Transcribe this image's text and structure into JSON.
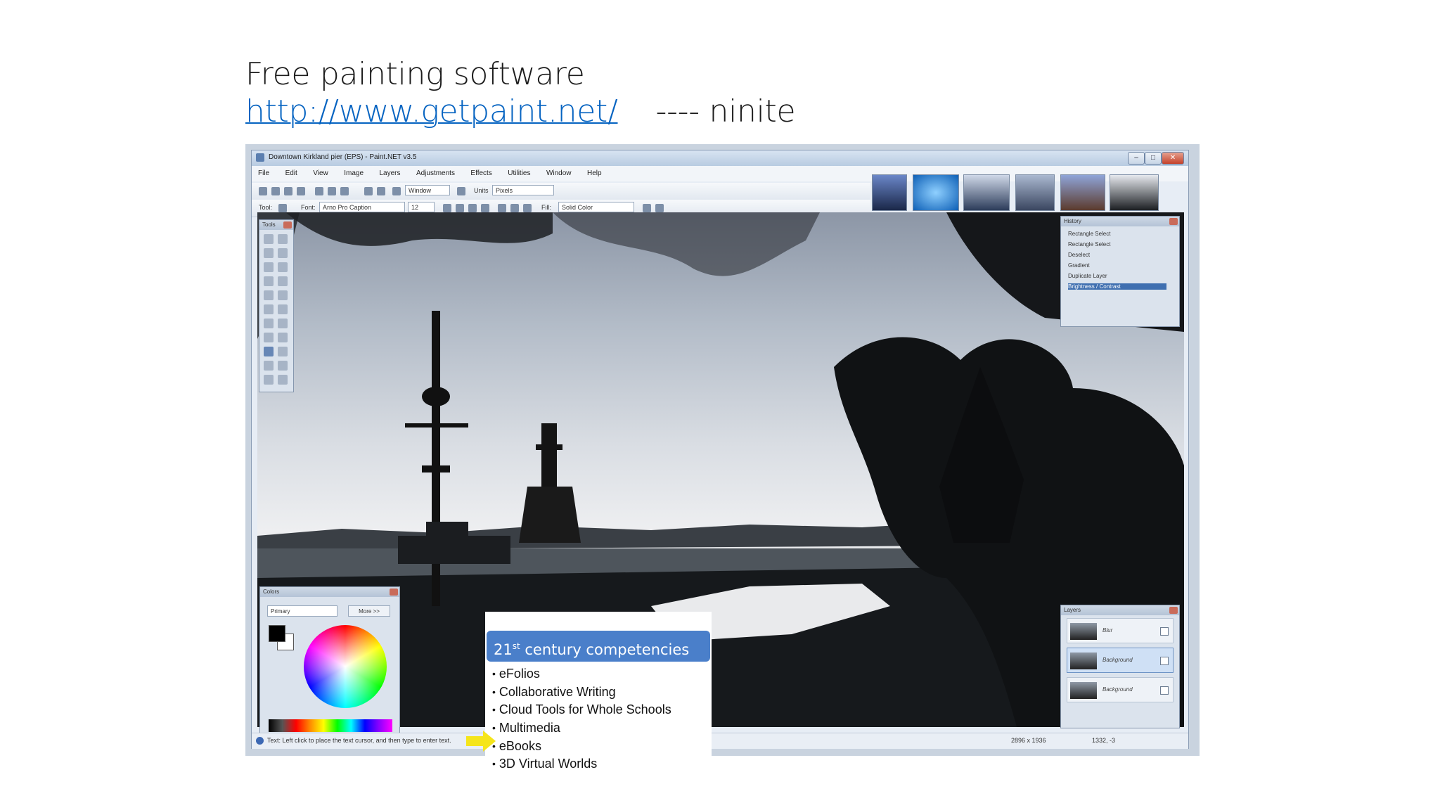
{
  "slide": {
    "title": "Free painting software",
    "link": "http://www.getpaint.net/",
    "link_suffix": "---- ninite"
  },
  "app": {
    "window_title": "Downtown Kirkland pier (EPS) - Paint.NET v3.5",
    "menu": [
      "File",
      "Edit",
      "View",
      "Image",
      "Layers",
      "Adjustments",
      "Effects",
      "Utilities",
      "Window",
      "Help"
    ],
    "toolbar": {
      "zoom": "Window",
      "units": "Units",
      "units_value": "Pixels",
      "tool_label": "Tool:",
      "font_label": "Font:",
      "font_name": "Arno Pro Caption",
      "font_size": "12",
      "fill_label": "Fill:",
      "fill_value": "Solid Color"
    },
    "tools_window": {
      "title": "Tools"
    },
    "history_window": {
      "title": "History",
      "items": [
        "Rectangle Select",
        "Rectangle Select",
        "Deselect",
        "Gradient",
        "Duplicate Layer",
        "Brightness / Contrast"
      ]
    },
    "colors_window": {
      "title": "Colors",
      "mode": "Primary",
      "more_button": "More >>"
    },
    "layers_window": {
      "title": "Layers",
      "layers": [
        "Blur",
        "Background",
        "Background"
      ]
    },
    "status": {
      "hint": "Text: Left click to place the text cursor, and then type to enter text.",
      "image_size": "2896 x 1936",
      "coords": "1332, -3"
    }
  },
  "callout": {
    "heading_prefix": "21",
    "heading_sup": "st",
    "heading_rest": " century competencies",
    "items": [
      "eFolios",
      "Collaborative Writing",
      "Cloud Tools for Whole Schools",
      "Multimedia",
      "eBooks",
      "3D Virtual Worlds"
    ]
  },
  "colors": {
    "link": "#0563c1",
    "callout_header": "#4a7fca",
    "arrow": "#f5e51b"
  }
}
